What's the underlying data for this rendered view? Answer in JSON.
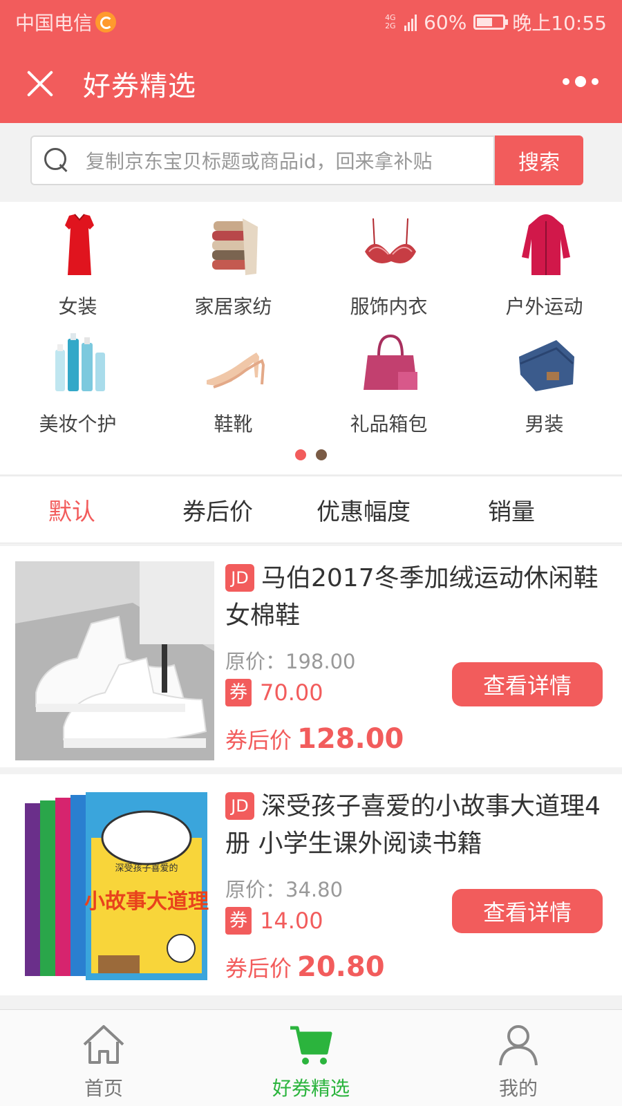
{
  "status_bar": {
    "carrier": "中国电信",
    "network": "4G 2G",
    "battery": "60%",
    "time": "晚上10:55"
  },
  "header": {
    "title": "好券精选",
    "close_icon": "close-icon",
    "more_icon": "more-dots-icon"
  },
  "search": {
    "placeholder": "复制京东宝贝标题或商品id，回来拿补贴",
    "button_label": "搜索"
  },
  "categories": [
    {
      "label": "女装",
      "icon": "dress-icon"
    },
    {
      "label": "家居家纺",
      "icon": "towels-icon"
    },
    {
      "label": "服饰内衣",
      "icon": "lingerie-icon"
    },
    {
      "label": "户外运动",
      "icon": "jacket-icon"
    },
    {
      "label": "美妆个护",
      "icon": "skincare-icon"
    },
    {
      "label": "鞋靴",
      "icon": "heels-icon"
    },
    {
      "label": "礼品箱包",
      "icon": "handbag-icon"
    },
    {
      "label": "男装",
      "icon": "jeans-icon"
    }
  ],
  "carousel": {
    "pages": 2,
    "active": 0
  },
  "sort_tabs": [
    {
      "label": "默认",
      "active": true
    },
    {
      "label": "券后价",
      "active": false
    },
    {
      "label": "优惠幅度",
      "active": false
    },
    {
      "label": "销量",
      "active": false
    }
  ],
  "products": [
    {
      "badge": "JD",
      "title": "马伯2017冬季加绒运动休闲鞋女棉鞋",
      "orig_label": "原价：",
      "orig_price": "198.00",
      "coupon_badge": "券",
      "coupon": "70.00",
      "final_label": "券后价",
      "final_price": "128.00",
      "button": "查看详情"
    },
    {
      "badge": "JD",
      "title": "深受孩子喜爱的小故事大道理4册 小学生课外阅读书籍",
      "orig_label": "原价：",
      "orig_price": "34.80",
      "coupon_badge": "券",
      "coupon": "14.00",
      "final_label": "券后价",
      "final_price": "20.80",
      "button": "查看详情",
      "book_cover_title": "小故事大道理",
      "book_cover_sub": "深受孩子喜爱的"
    }
  ],
  "tabbar": [
    {
      "label": "首页",
      "icon": "home-icon",
      "active": false
    },
    {
      "label": "好券精选",
      "icon": "cart-icon",
      "active": true
    },
    {
      "label": "我的",
      "icon": "user-icon",
      "active": false
    }
  ],
  "colors": {
    "brand_red": "#f25c5c",
    "active_green": "#2bb43d"
  }
}
